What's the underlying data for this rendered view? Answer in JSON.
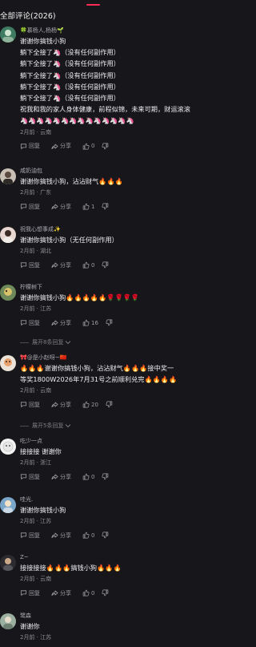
{
  "header": {
    "title": "全部评论(2026)"
  },
  "actions": {
    "reply": "回复",
    "share": "分享"
  },
  "icons": {
    "reply": "reply-icon",
    "share": "share-icon",
    "like": "thumb-up-icon",
    "dislike": "thumb-down-icon"
  },
  "colors": {
    "accent": "#fe2c55",
    "background": "#17171b"
  },
  "comments": [
    {
      "username": "🍀慕杨人,杨杨🌱",
      "lines": [
        "谢谢你搞钱小狗",
        "躺下全接了🦄（没有任何副作用）",
        "躺下全接了🦄（没有任何副作用）",
        "躺下全接了🦄（没有任何副作用）",
        "躺下全接了🦄（没有任何副作用）",
        "躺下全接了🦄（没有任何副作用）",
        "祝我和我的家人身体健康，前程似锦，未来可期，财运滚滚",
        "🦄🦄🦄🦄🦄🦄🦄🦄🦄🦄🦄🦄🦄🦄"
      ],
      "meta": "2月前 · 云南",
      "likes": "0"
    },
    {
      "username": "咸奶油包",
      "lines": [
        "谢谢你搞钱小狗，沾沾财气🔥🔥🔥"
      ],
      "meta": "2月前 · 广东",
      "likes": "1"
    },
    {
      "username": "祝我心想事成✨",
      "lines": [
        "谢谢你搞钱小狗（无任何副作用）"
      ],
      "meta": "2月前 · 湖北",
      "likes": "0"
    },
    {
      "username": "柠檬树下",
      "lines": [
        "谢谢你搞钱小狗🔥🔥🔥🔥🔥🌹🌹🌹🌹"
      ],
      "meta": "2月前 · 江苏",
      "likes": "16",
      "expand": "展开8条回复"
    },
    {
      "username": "🎀@是小赵呀~🇨🇳",
      "lines": [
        "🔥🔥🔥谢谢你搞钱小狗，沾沾财气🔥🔥🔥接中奖一",
        "等奖1800W2026年7月31号之前顺利兑完🔥🔥🔥🔥"
      ],
      "meta": "2月前 · 云南",
      "likes": "20",
      "expand": "展开5条回复"
    },
    {
      "username": "吃少一点",
      "lines": [
        "接接接 谢谢你"
      ],
      "meta": "2月前 · 浙江",
      "likes": "0"
    },
    {
      "username": "哇光.",
      "lines": [
        "谢谢你搞钱小狗"
      ],
      "meta": "2月前 · 江苏",
      "likes": "0"
    },
    {
      "username": "Z~",
      "lines": [
        "接接接接🔥🔥🔥搞钱小狗🔥🔥🔥"
      ],
      "meta": "2月前 · 云南",
      "likes": "0"
    },
    {
      "username": "鹭森",
      "lines": [
        "谢谢你"
      ],
      "meta": "2月前 · 江苏",
      "likes": "0"
    }
  ]
}
